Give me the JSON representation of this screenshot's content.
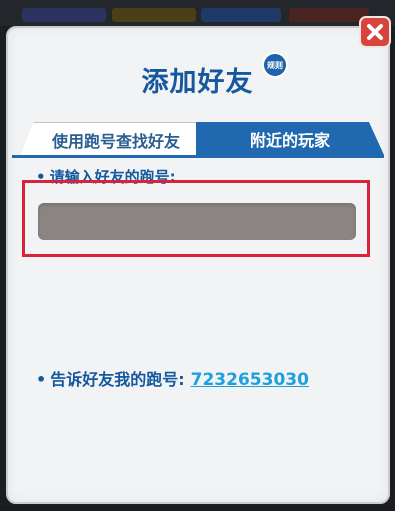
{
  "dialog": {
    "title": "添加好友",
    "rules_badge": "规则"
  },
  "tabs": [
    {
      "label": "使用跑号查找好友",
      "active": true
    },
    {
      "label": "附近的玩家",
      "active": false
    }
  ],
  "search": {
    "label": "请输入好友的跑号:",
    "value": "",
    "placeholder": ""
  },
  "share": {
    "label": "告诉好友我的跑号:",
    "runner_id": "7232653030"
  },
  "icons": {
    "close": "close-icon"
  },
  "colors": {
    "primary_blue": "#15589e",
    "tab_blue": "#2069b0",
    "close_red": "#d8433d",
    "highlight_red": "#d8233b",
    "input_gray": "#8b8482",
    "link_cyan": "#1ea0de"
  }
}
